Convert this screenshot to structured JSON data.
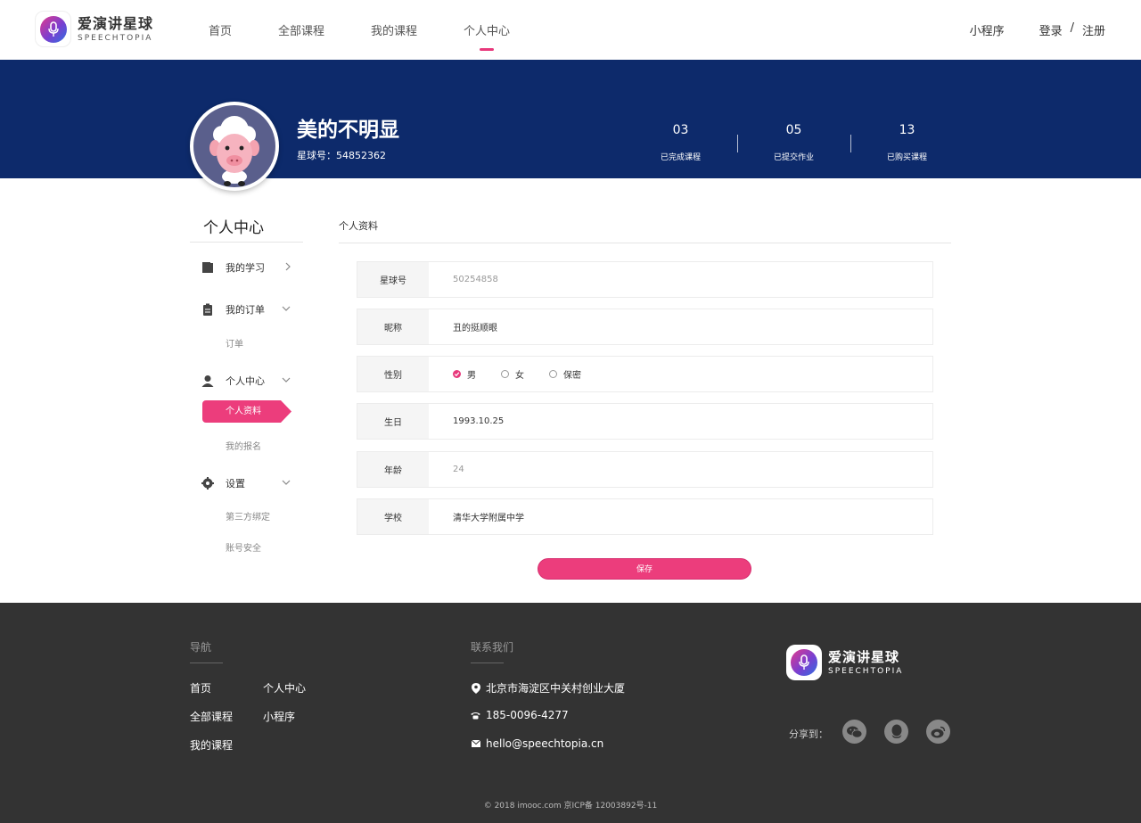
{
  "brand": {
    "name_cn": "爱演讲星球",
    "name_en": "SPEECHTOPIA",
    "accent": "#ec3d7c",
    "banner_color": "#0d2a6b"
  },
  "nav": {
    "items": [
      "首页",
      "全部课程",
      "我的课程",
      "个人中心"
    ],
    "active_index": 3
  },
  "header_right": {
    "mini_program": "小程序",
    "login": "登录",
    "separator": "/",
    "register": "注册"
  },
  "profile": {
    "name": "美的不明显",
    "id_text": "星球号：54852362",
    "stats": [
      {
        "value": "03",
        "label": "已完成课程"
      },
      {
        "value": "05",
        "label": "已提交作业"
      },
      {
        "value": "13",
        "label": "已购买课程"
      }
    ]
  },
  "sidebar": {
    "title": "个人中心",
    "items": [
      {
        "label": "我的学习",
        "icon": "book-icon",
        "chevron": "chevron-right-icon"
      },
      {
        "label": "我的订单",
        "icon": "clipboard-icon",
        "chevron": "chevron-down-icon"
      },
      {
        "label": "个人中心",
        "icon": "user-icon",
        "chevron": "chevron-down-icon"
      },
      {
        "label": "设置",
        "icon": "gear-icon",
        "chevron": "chevron-down-icon"
      }
    ],
    "sub": {
      "order": "订单",
      "profile": "个人资料",
      "signup": "我的报名",
      "third_party": "第三方绑定",
      "account_security": "账号安全"
    }
  },
  "main": {
    "title": "个人资料",
    "fields": [
      {
        "label": "星球号",
        "value": "50254858"
      },
      {
        "label": "昵称",
        "value": "丑的挺顺眼"
      },
      {
        "label": "性别",
        "options": [
          "男",
          "女",
          "保密"
        ],
        "selected": "男"
      },
      {
        "label": "生日",
        "value": "1993.10.25"
      },
      {
        "label": "年龄",
        "value": "24"
      },
      {
        "label": "学校",
        "value": "清华大学附属中学"
      }
    ],
    "save_label": "保存"
  },
  "footer": {
    "nav_title": "导航",
    "nav_links": [
      "首页",
      "个人中心",
      "全部课程",
      "小程序",
      "我的课程"
    ],
    "contact_title": "联系我们",
    "address": "北京市海淀区中关村创业大厦",
    "phone": "185-0096-4277",
    "email": "hello@speechtopia.cn",
    "share_label": "分享到：",
    "share_icons": [
      "wechat-icon",
      "qq-icon",
      "weibo-icon"
    ],
    "copyright": "© 2018 imooc.com  京ICP备 12003892号-11"
  }
}
